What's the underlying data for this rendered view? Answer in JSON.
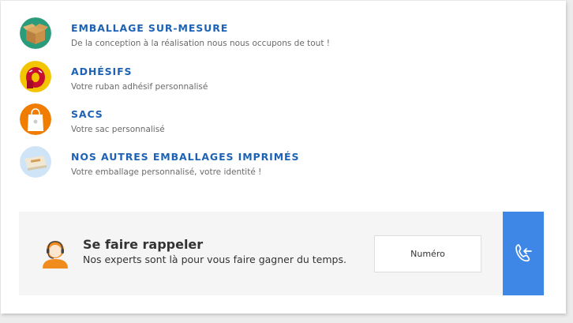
{
  "menu": {
    "items": [
      {
        "title": "EMBALLAGE SUR-MESURE",
        "subtitle": "De la conception à la réalisation nous nous occupons de tout !",
        "icon": "box-icon",
        "icon_bg": "#2a9b7b"
      },
      {
        "title": "ADHÉSIFS",
        "subtitle": "Votre ruban adhésif personnalisé",
        "icon": "tape-icon",
        "icon_bg": "#f2c500"
      },
      {
        "title": "SACS",
        "subtitle": "Votre sac personnalisé",
        "icon": "bag-icon",
        "icon_bg": "#f07d00"
      },
      {
        "title": "NOS AUTRES EMBALLAGES IMPRIMÉS",
        "subtitle": "Votre emballage personnalisé, votre identité !",
        "icon": "packaging-icon",
        "icon_bg": "#cfe4f7"
      }
    ]
  },
  "callback": {
    "title": "Se faire rappeler",
    "subtitle": "Nos experts sont là pour vous faire gagner du temps.",
    "placeholder": "Numéro",
    "icon": "agent-icon",
    "button_icon": "phone-callback-icon"
  },
  "colors": {
    "accent": "#1d62b4",
    "button": "#3f87e6",
    "panel_bg": "#f5f5f5"
  }
}
